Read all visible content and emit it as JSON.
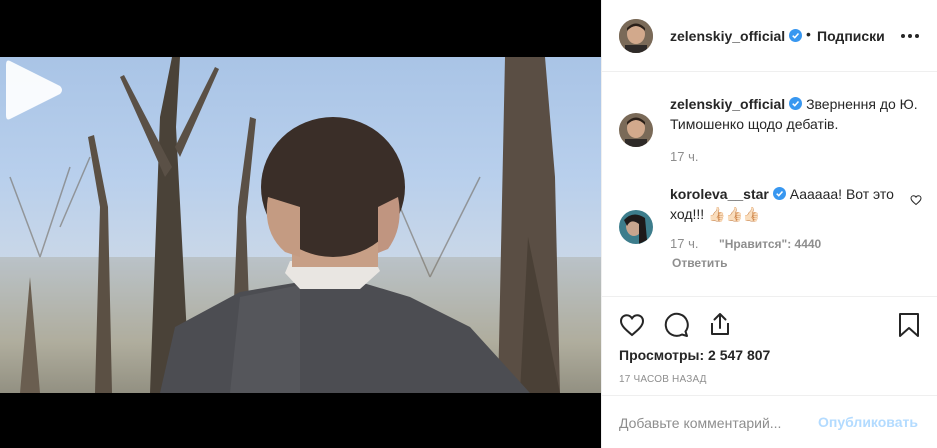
{
  "post": {
    "author": "zelenskiy_official",
    "follow_dot": "•",
    "follow_label": "Подписки",
    "caption": "Звернення до Ю. Тимошенко щодо дебатів.",
    "caption_time": "17 ч."
  },
  "comments": [
    {
      "user": "koroleva__star",
      "text": "Аааааа! Вот это ход!!! 👍🏻👍🏻👍🏻",
      "time": "17 ч.",
      "likes": "\"Нравится\": 4440",
      "reply_label": "Ответить"
    }
  ],
  "stats": {
    "views": "Просмотры: 2 547 807",
    "posted_ago": "17 ЧАСОВ НАЗАД"
  },
  "comment_form": {
    "placeholder": "Добавьте комментарий...",
    "publish_label": "Опубликовать"
  },
  "colors": {
    "verified": "#3897f0",
    "publish_disabled": "#b3dbff",
    "secondary_text": "#8e8e8e"
  },
  "icons": [
    "play-icon",
    "verified-icon",
    "more-icon",
    "heart-icon",
    "comment-icon",
    "share-icon",
    "bookmark-icon"
  ]
}
